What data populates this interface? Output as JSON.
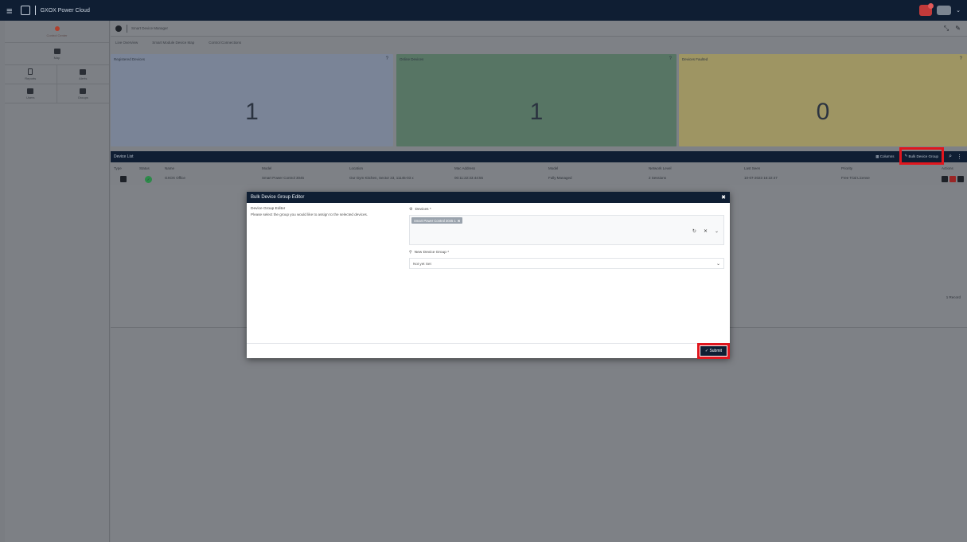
{
  "topbar": {
    "app_title": "GXOX Power Cloud"
  },
  "sidebar": {
    "header_label": "Control Center",
    "wide_item": "Map",
    "items": [
      {
        "label": "Reports"
      },
      {
        "label": "Alerts"
      },
      {
        "label": "Users"
      },
      {
        "label": "Groups"
      }
    ]
  },
  "breadcrumb": {
    "text": "Smart Device Manager"
  },
  "tabs": [
    "Live Overview",
    "Smart Module Device Map",
    "Control Connections"
  ],
  "cards": [
    {
      "title": "Registered Devices",
      "value": "1"
    },
    {
      "title": "Online Devices",
      "value": "1"
    },
    {
      "title": "Devices Faulted",
      "value": "0"
    }
  ],
  "table": {
    "title": "Device List",
    "tools": {
      "columns_label": "Columns",
      "bulk_label": "Bulk Device Group"
    },
    "columns": [
      "Type",
      "Status",
      "Name",
      "Model",
      "Location",
      "Mac Address",
      "Model",
      "Network Level",
      "Last Seen",
      "Priority",
      "Actions"
    ],
    "row": {
      "name": "GXOX Office",
      "model": "Smart Power Control 3045",
      "location": "Our Gym Kitchen, Sector 23, 11145-03 x",
      "mac": "00:11:22:33:44:55",
      "model2": "Fully Managed",
      "network": "2 Sessions",
      "last_seen": "10-07-2023 16:22:47",
      "priority": "Free Trial License"
    },
    "footer": "1 Record"
  },
  "modal": {
    "title": "Bulk Device Group Editor",
    "left_heading": "Device Group Editor",
    "left_desc": "Please select the group you would like to assign to the selected devices.",
    "devices_label": "Devices *",
    "device_chip": "Smart Power Control 3045 1",
    "new_group_label": "New Device Group *",
    "select_value": "Not yet Set",
    "submit_label": "Submit"
  }
}
